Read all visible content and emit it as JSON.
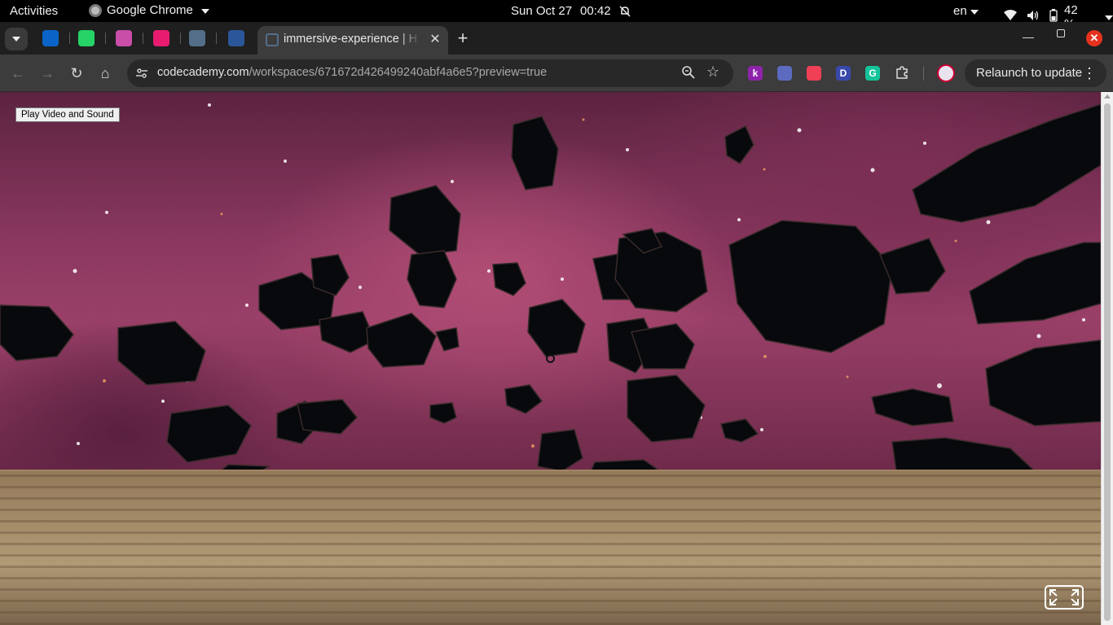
{
  "system_bar": {
    "activities": "Activities",
    "app_name": "Google Chrome",
    "date": "Sun Oct 27",
    "time": "00:42",
    "language": "en",
    "battery": "42 %"
  },
  "browser": {
    "tabs": {
      "pinned": [
        {
          "icon": "outlook-icon",
          "color": "#0a64c8"
        },
        {
          "icon": "whatsapp-icon",
          "color": "#25d366"
        },
        {
          "icon": "app-icon",
          "color": "#c94ea8"
        },
        {
          "icon": "app-icon",
          "color": "#e81b6f"
        },
        {
          "icon": "doc-icon",
          "color": "#546e8a"
        },
        {
          "icon": "word-icon",
          "color": "#2b579a"
        }
      ],
      "active_title": "immersive-experience | H"
    },
    "url": {
      "host": "codecademy.com",
      "path": "/workspaces/671672d426499240abf4a6e5?preview=true"
    },
    "extensions": [
      {
        "name": "k-extension-icon",
        "label": "k",
        "color": "#8e24aa"
      },
      {
        "name": "extension-icon",
        "label": "",
        "color": "#5c6bc0"
      },
      {
        "name": "pocket-icon",
        "label": "",
        "color": "#ef4056"
      },
      {
        "name": "d-extension-icon",
        "label": "D",
        "color": "#3949ab"
      },
      {
        "name": "grammarly-icon",
        "label": "G",
        "color": "#15c39a"
      }
    ],
    "relaunch_label": "Relaunch to update"
  },
  "page": {
    "play_button_label": "Play Video and Sound"
  }
}
